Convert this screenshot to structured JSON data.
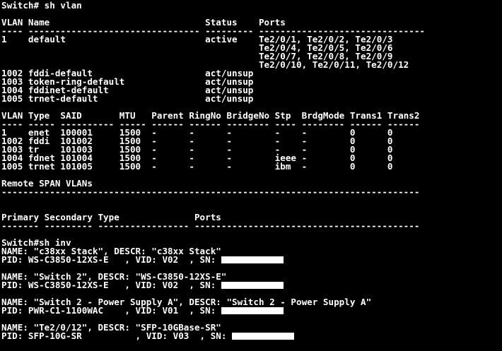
{
  "terminal": {
    "lines": [
      {
        "text": "Switch# sh vlan"
      },
      {
        "text": ""
      },
      {
        "text": "VLAN Name                             Status    Ports"
      },
      {
        "text": "---- -------------------------------- --------- -------------------------------"
      },
      {
        "text": "1    default                          active    Te2/0/1, Te2/0/2, Te2/0/3"
      },
      {
        "text": "                                                Te2/0/4, Te2/0/5, Te2/0/6"
      },
      {
        "text": "                                                Te2/0/7, Te2/0/8, Te2/0/9"
      },
      {
        "text": "                                                Te2/0/10, Te2/0/11, Te2/0/12"
      },
      {
        "text": "1002 fddi-default                     act/unsup"
      },
      {
        "text": "1003 token-ring-default               act/unsup"
      },
      {
        "text": "1004 fddinet-default                  act/unsup"
      },
      {
        "text": "1005 trnet-default                    act/unsup"
      },
      {
        "text": ""
      },
      {
        "text": "VLAN Type  SAID       MTU   Parent RingNo BridgeNo Stp  BrdgMode Trans1 Trans2"
      },
      {
        "text": "---- ----- ---------- ----- ------ ------ -------- ---- -------- ------ ------"
      },
      {
        "text": "1    enet  100001     1500  -      -      -        -    -        0      0"
      },
      {
        "text": "1002 fddi  101002     1500  -      -      -        -    -        0      0"
      },
      {
        "text": "1003 tr    101003     1500  -      -      -        -    -        0      0"
      },
      {
        "text": "1004 fdnet 101004     1500  -      -      -        ieee -        0      0"
      },
      {
        "text": "1005 trnet 101005     1500  -      -      -        ibm  -        0      0"
      },
      {
        "text": ""
      },
      {
        "text": "Remote SPAN VLANs"
      },
      {
        "text": "------------------------------------------------------------------------------"
      },
      {
        "text": ""
      },
      {
        "text": ""
      },
      {
        "text": "Primary Secondary Type              Ports"
      },
      {
        "text": "------- --------- ----------------- ------------------------------------------"
      },
      {
        "text": ""
      },
      {
        "text": "Switch#sh inv"
      },
      {
        "text": "NAME: \"c38xx Stack\", DESCR: \"c38xx Stack\""
      },
      {
        "text": "PID: WS-C3850-12XS-E   , VID: V02  , SN: ",
        "redact": true
      },
      {
        "text": ""
      },
      {
        "text": "NAME: \"Switch 2\", DESCR: \"WS-C3850-12XS-E\""
      },
      {
        "text": "PID: WS-C3850-12XS-E   , VID: V02  , SN: ",
        "redact": true
      },
      {
        "text": ""
      },
      {
        "text": "NAME: \"Switch 2 - Power Supply A\", DESCR: \"Switch 2 - Power Supply A\""
      },
      {
        "text": "PID: PWR-C1-1100WAC    , VID: V01  , SN: ",
        "redact": true
      },
      {
        "text": ""
      },
      {
        "text": "NAME: \"Te2/0/12\", DESCR: \"SFP-10GBase-SR\""
      },
      {
        "text": "PID: SFP-10G-SR          , VID: V03  , SN: ",
        "redact": true
      }
    ]
  }
}
